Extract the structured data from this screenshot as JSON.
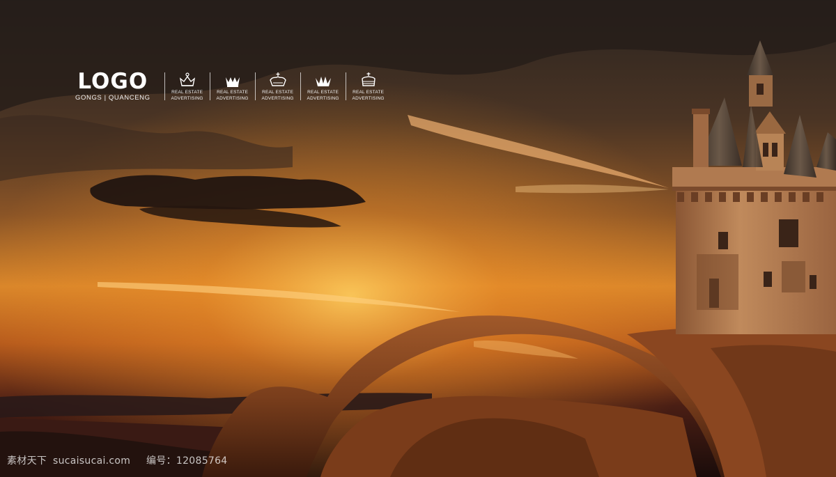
{
  "brand": {
    "logo_text": "LOGO",
    "logo_subtext": "GONGS | QUANCENG"
  },
  "badges": [
    {
      "icon": "crown-icon",
      "line1": "REAL ESTATE",
      "line2": "ADVERTISING"
    },
    {
      "icon": "crown-icon",
      "line1": "REAL ESTATE",
      "line2": "ADVERTISING"
    },
    {
      "icon": "crown-icon",
      "line1": "REAL ESTATE",
      "line2": "ADVERTISING"
    },
    {
      "icon": "crown-icon",
      "line1": "REAL ESTATE",
      "line2": "ADVERTISING"
    },
    {
      "icon": "crown-icon",
      "line1": "REAL ESTATE",
      "line2": "ADVERTISING"
    }
  ],
  "watermark": {
    "site_name": "素材天下",
    "site_url": "sucaisucai.com",
    "id_label": "编号：",
    "id_number": "12085764"
  },
  "colors": {
    "sky_top": "#2a1f1a",
    "sky_glow": "#f0a030",
    "horizon": "#e8902a",
    "rock": "#8a4a22",
    "castle": "#b57a4e",
    "logo_accent": "#f0a030"
  }
}
